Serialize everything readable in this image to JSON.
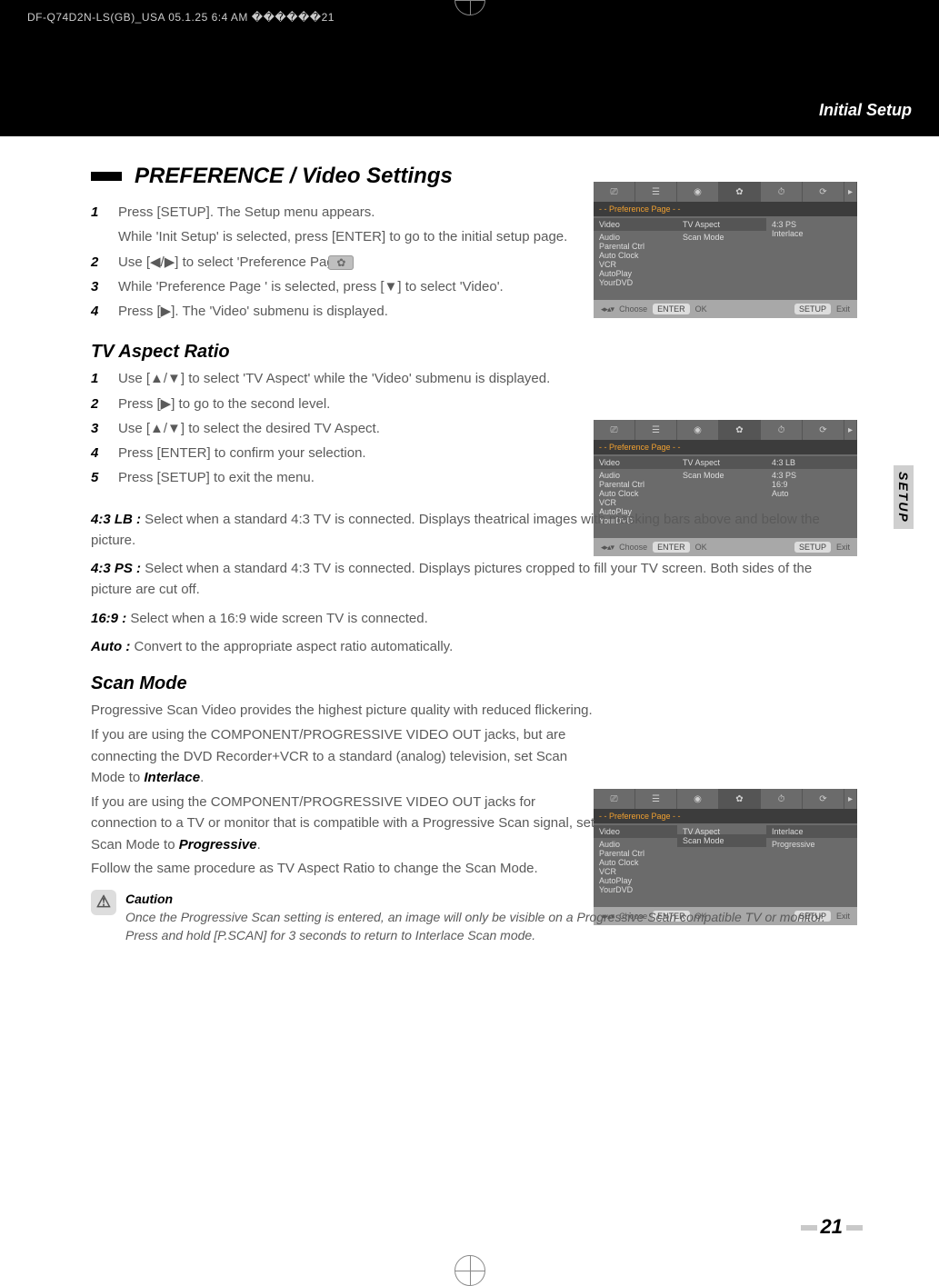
{
  "header": {
    "meta": "DF-Q74D2N-LS(GB)_USA  05.1.25 6:4 AM  ������21",
    "breadcrumb": "Initial Setup"
  },
  "side_tab": "SETUP",
  "page_number": "21",
  "section": {
    "title": "PREFERENCE / Video Settings",
    "steps": [
      "Press [SETUP].  The Setup menu appears.",
      "Use [◀/▶] to select 'Preference Page       '.",
      "While 'Preference Page        ' is selected, press [▼] to select 'Video'.",
      "Press [▶]. The 'Video' submenu is displayed."
    ],
    "step1_sub": "While 'Init Setup' is selected, press [ENTER] to go to the initial setup page."
  },
  "tv_aspect": {
    "title": "TV Aspect Ratio",
    "steps": [
      "Use [▲/▼] to select 'TV Aspect' while the 'Video' submenu is displayed.",
      "Press [▶] to go to the second level.",
      "Use [▲/▼] to select the desired TV Aspect.",
      "Press [ENTER] to confirm your selection.",
      "Press [SETUP] to exit the menu."
    ],
    "defs": {
      "lb_label": "4:3 LB :",
      "lb_text": "  Select when a standard 4:3 TV is connected. Displays theatrical images with masking bars above and below the picture.",
      "ps_label": "4:3 PS :",
      "ps_text": "  Select when a standard 4:3 TV is connected. Displays pictures cropped to fill your TV screen. Both sides of the picture are cut off.",
      "w_label": "16:9 :",
      "w_text": "  Select when a 16:9 wide screen TV is connected.",
      "auto_label": "Auto :",
      "auto_text": "  Convert to the appropriate aspect ratio automatically."
    }
  },
  "scan_mode": {
    "title": "Scan Mode",
    "intro": "Progressive Scan Video provides the highest picture quality with reduced flickering.",
    "b1a": "If you are using the COMPONENT/PROGRESSIVE VIDEO OUT jacks, but are connecting the DVD Recorder+VCR to a standard (analog) television, set Scan Mode to ",
    "b1_strong": "Interlace",
    "b2a": "If you are using the COMPONENT/PROGRESSIVE VIDEO OUT jacks for connection to a TV or monitor that is compatible with a Progressive Scan signal, set Scan Mode to ",
    "b2_strong": "Progressive",
    "follow": "Follow the same procedure as TV Aspect Ratio to change the Scan Mode."
  },
  "caution": {
    "label": "Caution",
    "text": "Once the Progressive Scan setting is entered, an image will only be visible on a Progressive Scan compatible TV or monitor. Press and hold [P.SCAN] for 3 seconds to return to Interlace Scan mode."
  },
  "osd_common": {
    "title": "- - Preference Page - -",
    "left_items": [
      "Video",
      "Audio",
      "Parental Ctrl",
      "Auto Clock",
      "VCR",
      "AutoPlay",
      "YourDVD"
    ],
    "mid_items": [
      "TV Aspect",
      "Scan Mode"
    ],
    "footer": {
      "choose": "Choose",
      "ok": "OK",
      "exit": "Exit",
      "enter": "ENTER",
      "setup": "SETUP"
    }
  },
  "osd1_right": [
    "4:3 PS",
    "Interlace"
  ],
  "osd2_right": [
    "4:3 LB",
    "4:3 PS",
    "16:9",
    "Auto"
  ],
  "osd3_right": [
    "Interlace",
    "Progressive"
  ]
}
